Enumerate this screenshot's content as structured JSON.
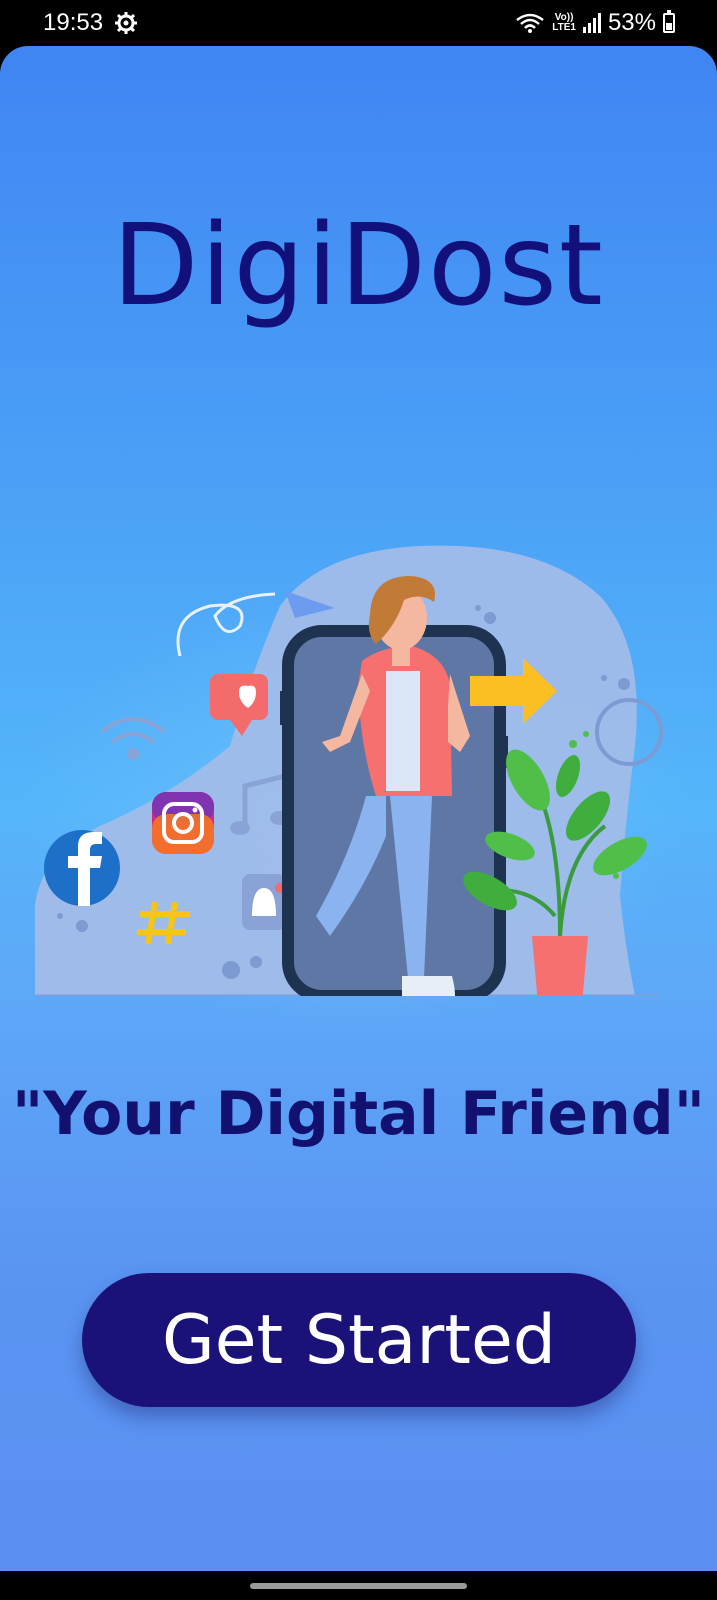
{
  "status_bar": {
    "time": "19:53",
    "lte_top": "Vo))",
    "lte_bottom": "LTE1",
    "battery_percent": "53%",
    "battery_level": 0.53
  },
  "app": {
    "title": "DigiDost",
    "tagline": "\"Your Digital Friend\"",
    "cta_label": "Get Started"
  },
  "colors": {
    "title": "#12107a",
    "button": "#1a1278",
    "background_top": "#4085f3",
    "background_mid": "#55b5fa"
  }
}
